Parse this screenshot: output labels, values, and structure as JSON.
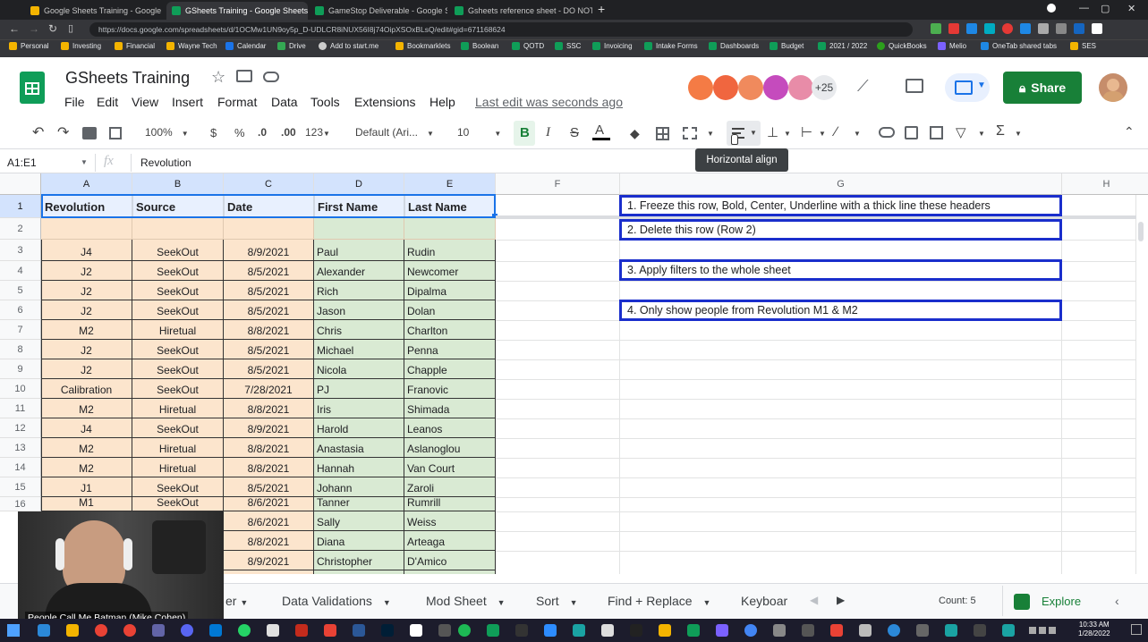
{
  "browser": {
    "tabs": [
      {
        "title": "Google Sheets Training - Google Slides",
        "color": "#f4b400"
      },
      {
        "title": "GSheets Training - Google Sheets",
        "color": "#0f9d58"
      },
      {
        "title": "GameStop Deliverable - Google Sheets",
        "color": "#0f9d58"
      },
      {
        "title": "Gsheets reference sheet - DO NOT AL",
        "color": "#0f9d58"
      }
    ],
    "url": "https://docs.google.com/spreadsheets/d/1OCMw1UN9oy5p_D-UDLCR8iNUX56I8j74OipXSOxBLsQ/edit#gid=671168624",
    "bookmarks": [
      "Personal",
      "Investing",
      "Financial",
      "Wayne Tech",
      "Calendar",
      "Drive",
      "Add to start.me",
      "Bookmarklets",
      "Boolean",
      "QOTD",
      "SSC",
      "Invoicing",
      "Intake Forms",
      "Dashboards",
      "Budget",
      "2021 / 2022",
      "QuickBooks",
      "Melio",
      "OneTab shared tabs",
      "SES"
    ]
  },
  "header": {
    "title": "GSheets Training",
    "menus": [
      "File",
      "Edit",
      "View",
      "Insert",
      "Format",
      "Data",
      "Tools",
      "Extensions",
      "Help"
    ],
    "last_edit": "Last edit was seconds ago",
    "collaborators_extra": "+25",
    "share_label": "Share"
  },
  "toolbar": {
    "zoom": "100%",
    "currency": "$",
    "percent": "%",
    "dec_less": ".0",
    "dec_more": ".00",
    "format_more": "123",
    "font": "Default (Ari...",
    "font_size": "10",
    "bold": "B",
    "italic": "I",
    "strike": "S",
    "text_color": "A",
    "tooltip": "Horizontal align"
  },
  "formula_bar": {
    "name_box": "A1:E1",
    "fx": "fx",
    "content": "Revolution"
  },
  "grid": {
    "columns": [
      "A",
      "B",
      "C",
      "D",
      "E",
      "F",
      "G",
      "H"
    ],
    "headers": [
      "Revolution",
      "Source",
      "Date",
      "First Name",
      "Last Name"
    ],
    "row_numbers": [
      "1",
      "2",
      "3",
      "4",
      "5",
      "6",
      "7",
      "8",
      "9",
      "10",
      "11",
      "12",
      "13",
      "14",
      "15",
      "16"
    ],
    "rows": [
      [
        "J4",
        "SeekOut",
        "8/9/2021",
        "Paul",
        "Rudin"
      ],
      [
        "J2",
        "SeekOut",
        "8/5/2021",
        "Alexander",
        "Newcomer"
      ],
      [
        "J2",
        "SeekOut",
        "8/5/2021",
        "Rich",
        "Dipalma"
      ],
      [
        "J2",
        "SeekOut",
        "8/5/2021",
        "Jason",
        "Dolan"
      ],
      [
        "M2",
        "Hiretual",
        "8/8/2021",
        "Chris",
        "Charlton"
      ],
      [
        "J2",
        "SeekOut",
        "8/5/2021",
        "Michael",
        "Penna"
      ],
      [
        "J2",
        "SeekOut",
        "8/5/2021",
        "Nicola",
        "Chapple"
      ],
      [
        "Calibration",
        "SeekOut",
        "7/28/2021",
        "PJ",
        "Franovic"
      ],
      [
        "M2",
        "Hiretual",
        "8/8/2021",
        "Iris",
        "Shimada"
      ],
      [
        "J4",
        "SeekOut",
        "8/9/2021",
        "Harold",
        "Leanos"
      ],
      [
        "M2",
        "Hiretual",
        "8/8/2021",
        "Anastasia",
        "Aslanoglou"
      ],
      [
        "M2",
        "Hiretual",
        "8/8/2021",
        "Hannah",
        "Van Court"
      ],
      [
        "J1",
        "SeekOut",
        "8/5/2021",
        "Johann",
        "Zaroli"
      ],
      [
        "M1",
        "SeekOut",
        "8/6/2021",
        "Tanner",
        "Rumrill"
      ]
    ],
    "partial_rows": [
      [
        "8/6/2021",
        "Sally",
        "Weiss"
      ],
      [
        "8/8/2021",
        "Diana",
        "Arteaga"
      ],
      [
        "8/9/2021",
        "Christopher",
        "D'Amico"
      ]
    ],
    "tasks": [
      "1.  Freeze this row, Bold, Center, Underline with a thick line these headers",
      "2.  Delete this row (Row 2)",
      "3.  Apply filters to the whole sheet",
      "4.  Only show people from Revolution M1 & M2"
    ]
  },
  "sheet_tabs": {
    "partial": "er",
    "tabs": [
      "Data Validations",
      "Mod Sheet",
      "Sort",
      "Find + Replace",
      "Keyboar"
    ],
    "count": "Count: 5",
    "explore": "Explore"
  },
  "webcam": {
    "caption": "People Call Me Batman (Mike Cohen)"
  },
  "taskbar": {
    "time": "10:33 AM",
    "date": "1/28/2022"
  },
  "colors": {
    "accent_green": "#188038",
    "task_border": "#1a2ecc",
    "orange_fill": "#fce5cd",
    "green_fill": "#d9ead3",
    "select_blue": "#1a73e8"
  }
}
